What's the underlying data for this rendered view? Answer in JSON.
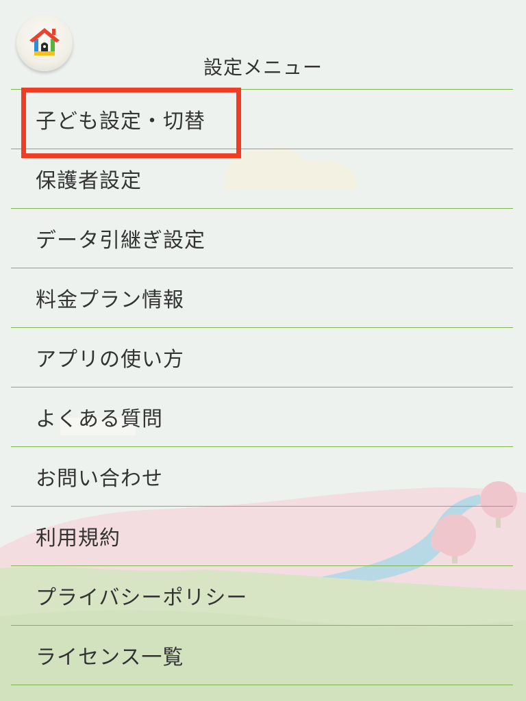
{
  "header": {
    "title": "設定メニュー",
    "home_icon": "home-icon"
  },
  "menu": {
    "items": [
      {
        "label": "子ども設定・切替",
        "highlighted": true
      },
      {
        "label": "保護者設定"
      },
      {
        "label": "データ引継ぎ設定"
      },
      {
        "label": "料金プラン情報"
      },
      {
        "label": "アプリの使い方"
      },
      {
        "label": "よくある質問"
      },
      {
        "label": "お問い合わせ"
      },
      {
        "label": "利用規約"
      },
      {
        "label": "プライバシーポリシー"
      },
      {
        "label": "ライセンス一覧"
      }
    ]
  },
  "colors": {
    "divider": "#7fb54f",
    "highlight": "#f03c24",
    "background": "#eef2ef",
    "home_roof": "#e8432e",
    "home_wall_blue": "#2d8ed6",
    "home_wall_green": "#58b33c",
    "home_base_yellow": "#f4c21b"
  }
}
